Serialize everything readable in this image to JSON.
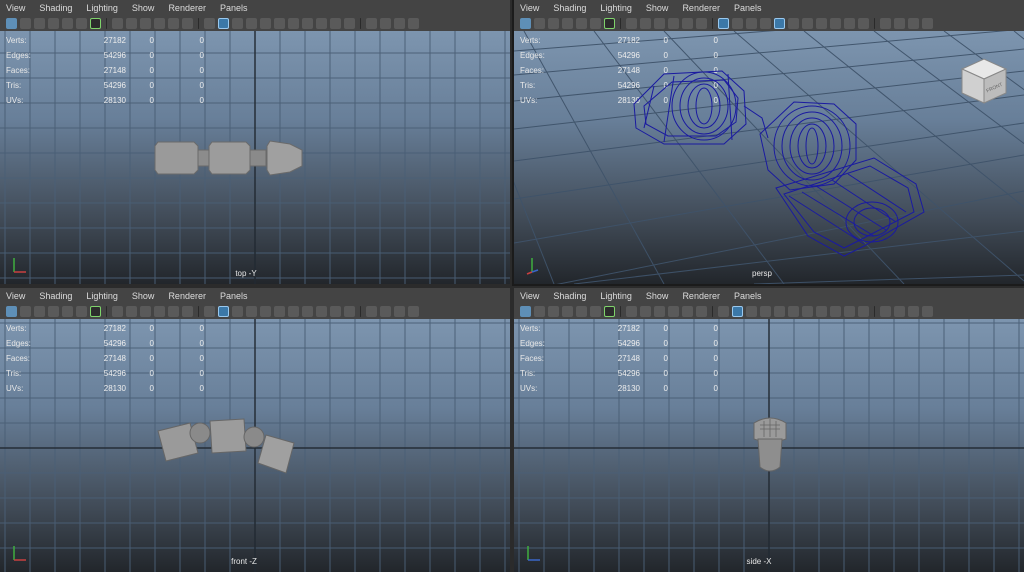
{
  "menus": [
    "View",
    "Shading",
    "Lighting",
    "Show",
    "Renderer",
    "Panels"
  ],
  "hud": {
    "rows": [
      {
        "label": "Verts:",
        "v1": "27182",
        "v2": "0",
        "v3": "0"
      },
      {
        "label": "Edges:",
        "v1": "54296",
        "v2": "0",
        "v3": "0"
      },
      {
        "label": "Faces:",
        "v1": "27148",
        "v2": "0",
        "v3": "0"
      },
      {
        "label": "Tris:",
        "v1": "54296",
        "v2": "0",
        "v3": "0"
      },
      {
        "label": "UVs:",
        "v1": "28130",
        "v2": "0",
        "v3": "0"
      }
    ]
  },
  "panes": {
    "top": {
      "camera": "top -Y"
    },
    "persp": {
      "camera": "persp"
    },
    "front": {
      "camera": "front -Z"
    },
    "side": {
      "camera": "side -X"
    }
  },
  "viewcube": {
    "label": "FRONT"
  },
  "colors": {
    "wireframe": "#1a1aa0",
    "selected_tool": "#7fd36b",
    "active_icon": "#5e8fb7"
  }
}
